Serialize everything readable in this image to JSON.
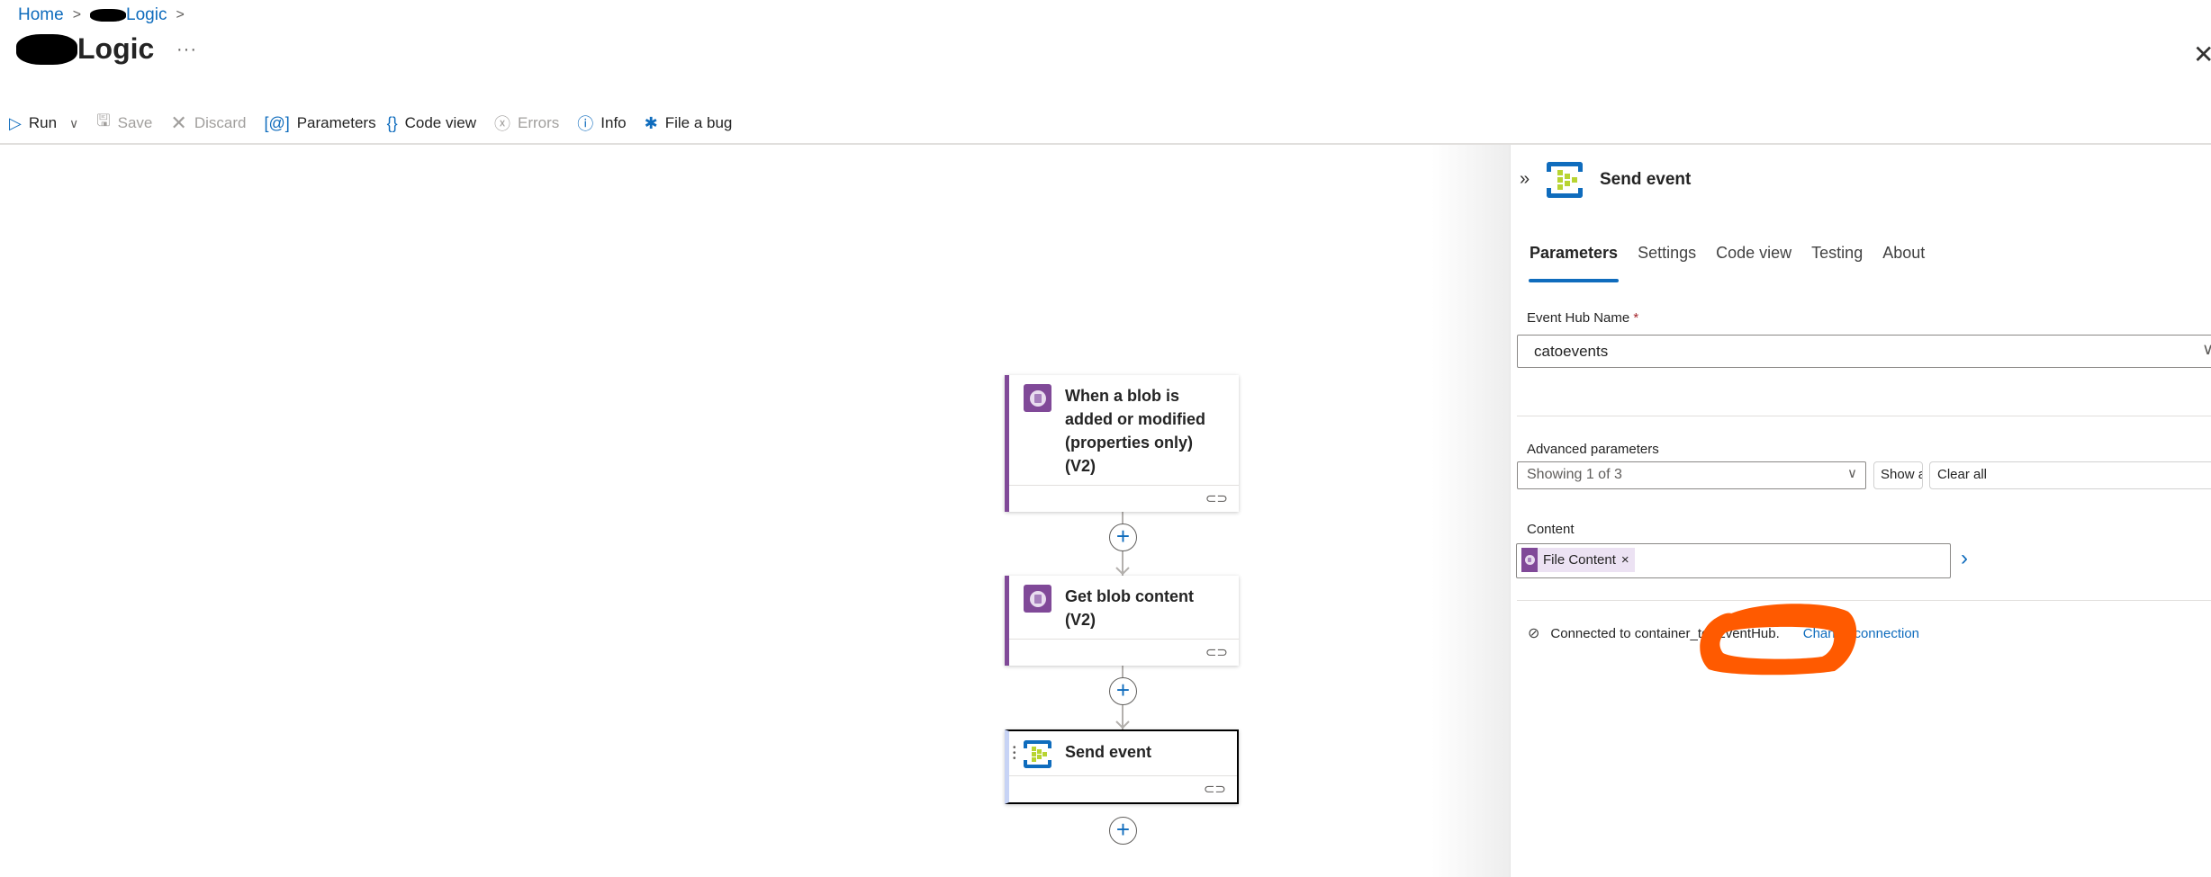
{
  "breadcrumb": {
    "items": [
      {
        "label": "Home"
      },
      {
        "label": "Logic"
      }
    ]
  },
  "header": {
    "title": "Logic",
    "more_label": "···",
    "close_icon": "close-icon"
  },
  "toolbar": {
    "items": [
      {
        "label": "Run",
        "icon": "play-icon",
        "disabled": false
      },
      {
        "label": "Save",
        "icon": "save-icon",
        "disabled": true
      },
      {
        "label": "Discard",
        "icon": "discard-icon",
        "disabled": true
      },
      {
        "label": "Parameters",
        "icon": "parameters-icon",
        "disabled": false
      },
      {
        "label": "Code view",
        "icon": "code-icon",
        "disabled": false
      },
      {
        "label": "Errors",
        "icon": "errors-icon",
        "disabled": true
      },
      {
        "label": "Info",
        "icon": "info-icon",
        "disabled": false
      },
      {
        "label": "File a bug",
        "icon": "bug-icon",
        "disabled": false
      }
    ]
  },
  "canvas": {
    "nodes": [
      {
        "title": "When a blob is added or modified (properties only) (V2)",
        "icon": "blob-storage-icon"
      },
      {
        "title": "Get blob content (V2)",
        "icon": "blob-storage-icon"
      },
      {
        "title": "Send event",
        "icon": "event-hub-icon",
        "selected": true
      }
    ]
  },
  "panel": {
    "title": "Send event",
    "tabs": [
      {
        "label": "Parameters",
        "active": true
      },
      {
        "label": "Settings"
      },
      {
        "label": "Code view"
      },
      {
        "label": "Testing"
      },
      {
        "label": "About"
      }
    ],
    "event_hub_name": {
      "label": "Event Hub Name",
      "required_mark": "*",
      "value": "catoevents"
    },
    "advanced": {
      "label": "Advanced parameters",
      "value": "Showing 1 of 3",
      "show_all_label": "Show all",
      "clear_all_label": "Clear all"
    },
    "content": {
      "label": "Content",
      "token_label": "File Content",
      "token_remove": "×"
    },
    "connection": {
      "text": "Connected to container_to_EventHub.",
      "change_label": "Change connection"
    }
  },
  "colors": {
    "accent": "#0f6cbd",
    "blob_purple": "#804998",
    "event_hub_green": "#b8d432",
    "annotation_orange": "#ff5a00"
  }
}
